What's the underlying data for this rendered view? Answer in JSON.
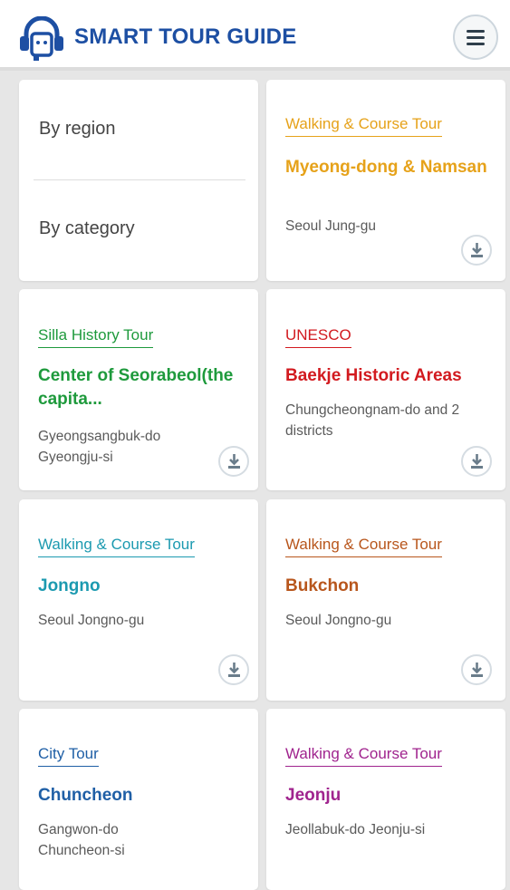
{
  "app": {
    "title": "SMART TOUR GUIDE"
  },
  "filters": {
    "region": "By region",
    "category": "By category"
  },
  "tours": [
    {
      "category": "Walking & Course Tour",
      "title": "Myeong-dong & Namsan",
      "location": "Seoul Jung-gu",
      "color": "#e6a21a"
    },
    {
      "category": "Silla History Tour",
      "title": "Center of Seorabeol(the capita...",
      "location": "Gyeongsangbuk-do Gyeongju-si",
      "color": "#1e9a3c"
    },
    {
      "category": "UNESCO",
      "title": "Baekje Historic Areas",
      "location": "Chungcheongnam-do and 2 districts",
      "color": "#d21a1f"
    },
    {
      "category": "Walking & Course Tour",
      "title": "Jongno",
      "location": "Seoul Jongno-gu",
      "color": "#1c9ab0"
    },
    {
      "category": "Walking & Course Tour",
      "title": "Bukchon",
      "location": "Seoul Jongno-gu",
      "color": "#b8561c"
    },
    {
      "category": "City Tour",
      "title": "Chuncheon",
      "location": "Gangwon-do Chuncheon-si",
      "color": "#1f5fa6"
    },
    {
      "category": "Walking & Course Tour",
      "title": "Jeonju",
      "location": "Jeollabuk-do Jeonju-si",
      "color": "#a0248e"
    }
  ],
  "icons": {
    "logo": "headphone-guide-icon",
    "menu": "hamburger-icon",
    "download": "download-icon"
  }
}
